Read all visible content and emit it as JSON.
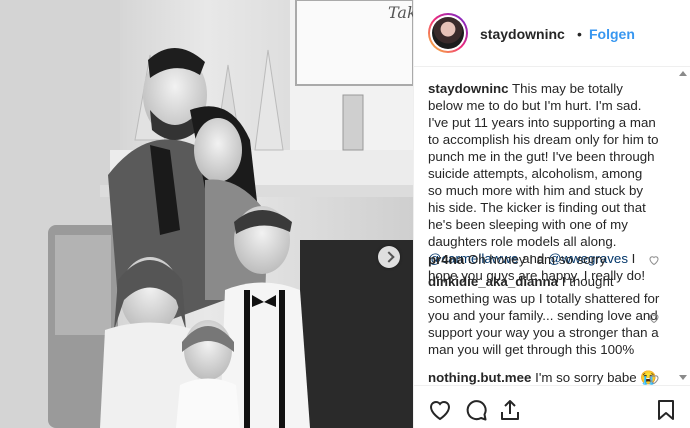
{
  "header": {
    "username": "staydowninc",
    "separator": "•",
    "follow_label": "Folgen"
  },
  "caption": {
    "username": "staydowninc",
    "text_part1": "This may be totally below me to do but I'm hurt. I'm sad. I've put 11 years into supporting a man to accomplish his dream only for him to punch me in the gut! I've been through suicide attempts, alcoholism, among so much more with him and stuck by his side. The kicker is finding out that he's been sleeping with one of my daughters role models all along.",
    "mention1": "@carmellawwe",
    "and": "and",
    "mention2": "@wwegraves",
    "text_part2": "I hope you guys are happy. I really do!"
  },
  "comments": [
    {
      "username": "pr4na",
      "text": "Oh honey I am so sorry"
    },
    {
      "username": "dinkidie_aka_dianna",
      "text": "I thought something was up I totally shattered for you and your family... sending love and support your way you a stronger than a man you will get through this 100%"
    },
    {
      "username": "nothing.but.mee",
      "text": "I'm so sorry babe 😭"
    }
  ],
  "photo": {
    "sign_text": "Tak"
  },
  "icons": {
    "like": "heart-icon",
    "comment": "comment-icon",
    "share": "share-icon",
    "save": "bookmark-icon",
    "next": "chevron-right-icon"
  },
  "colors": {
    "link": "#3897f0",
    "mention": "#003569",
    "text": "#262626",
    "border": "#efefef"
  }
}
